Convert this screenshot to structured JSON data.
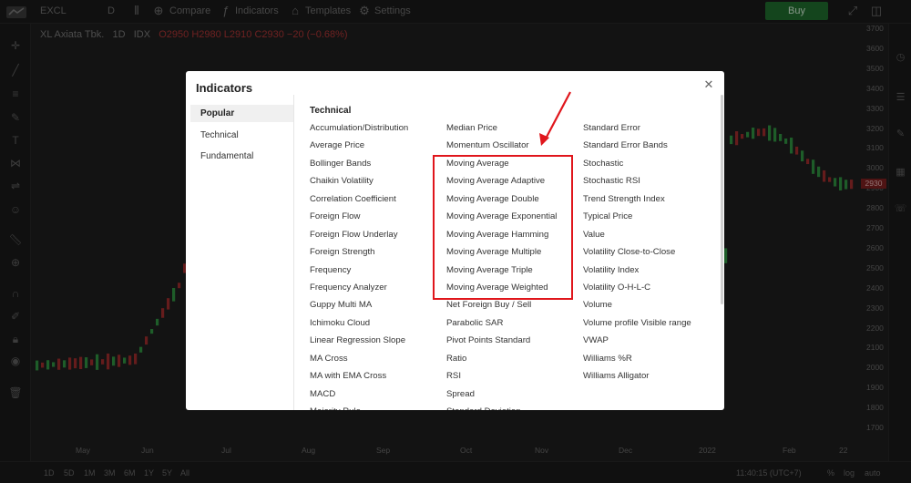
{
  "topbar": {
    "symbol_input": "EXCL",
    "interval": "D",
    "compare_label": "Compare",
    "indicators_label": "Indicators",
    "templates_label": "Templates",
    "settings_label": "Settings",
    "buy_label": "Buy"
  },
  "legend": {
    "symbol_name": "XL Axiata Tbk.",
    "interval": "1D",
    "exchange": "IDX",
    "ohlc": "O2950 H2980 L2910 C2930 −20 (−0.68%)"
  },
  "price_axis": {
    "labels": [
      "3700",
      "3600",
      "3500",
      "3400",
      "3300",
      "3200",
      "3100",
      "3000",
      "2900",
      "2800",
      "2700",
      "2600",
      "2500",
      "2400",
      "2300",
      "2200",
      "2100",
      "2000",
      "1900",
      "1800",
      "1700"
    ],
    "current_price": "2930"
  },
  "time_axis": {
    "labels": [
      "May",
      "Jun",
      "Jul",
      "Aug",
      "Sep",
      "Oct",
      "Nov",
      "Dec",
      "2022",
      "Feb",
      "22"
    ]
  },
  "bottombar": {
    "ranges": [
      "1D",
      "5D",
      "1M",
      "3M",
      "6M",
      "1Y",
      "5Y",
      "All"
    ],
    "clock": "11:40:15 (UTC+7)",
    "percent": "%",
    "log": "log",
    "auto": "auto"
  },
  "modal": {
    "title": "Indicators",
    "close_icon": "close-icon",
    "categories": [
      "Popular",
      "Technical",
      "Fundamental"
    ],
    "active_category": "Popular",
    "section_title": "Technical",
    "columns": [
      [
        "Accumulation/Distribution",
        "Average Price",
        "Bollinger Bands",
        "Chaikin Volatility",
        "Correlation Coefficient",
        "Foreign Flow",
        "Foreign Flow Underlay",
        "Foreign Strength",
        "Frequency",
        "Frequency Analyzer",
        "Guppy Multi MA",
        "Ichimoku Cloud",
        "Linear Regression Slope",
        "MA Cross",
        "MA with EMA Cross",
        "MACD",
        "Majority Rule"
      ],
      [
        "Median Price",
        "Momentum Oscillator",
        "Moving Average",
        "Moving Average Adaptive",
        "Moving Average Double",
        "Moving Average Exponential",
        "Moving Average Hamming",
        "Moving Average Multiple",
        "Moving Average Triple",
        "Moving Average Weighted",
        "Net Foreign Buy / Sell",
        "Parabolic SAR",
        "Pivot Points Standard",
        "Ratio",
        "RSI",
        "Spread",
        "Standard Deviation"
      ],
      [
        "Standard Error",
        "Standard Error Bands",
        "Stochastic",
        "Stochastic RSI",
        "Trend Strength Index",
        "Typical Price",
        "Value",
        "Volatility Close-to-Close",
        "Volatility Index",
        "Volatility O-H-L-C",
        "Volume",
        "Volume profile Visible range",
        "VWAP",
        "Williams %R",
        "Williams Alligator"
      ]
    ]
  },
  "colors": {
    "highlight": "#e0161c",
    "buy": "#1f6b2d"
  }
}
